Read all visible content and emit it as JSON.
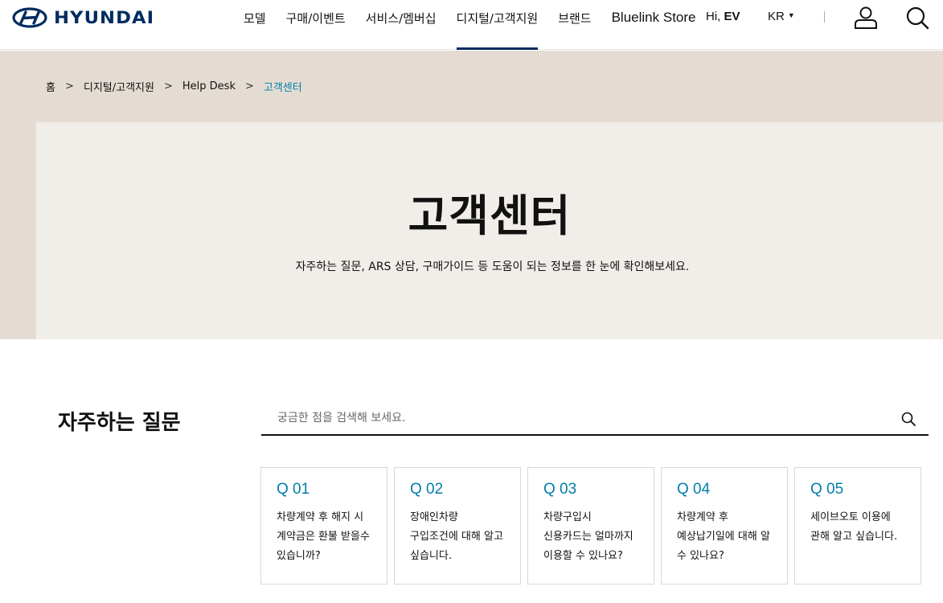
{
  "header": {
    "logo_text": "HYUNDAI",
    "nav": [
      "모델",
      "구매/이벤트",
      "서비스/멤버십",
      "디지털/고객지원",
      "브랜드",
      "Bluelink Store"
    ],
    "active_nav_index": 3,
    "greeting_prefix": "Hi, ",
    "greeting_name": "EV",
    "language": "KR",
    "icons": [
      "user-icon",
      "search-icon"
    ]
  },
  "breadcrumb": [
    "홈",
    "디지털/고객지원",
    "Help Desk",
    "고객센터"
  ],
  "hero": {
    "title": "고객센터",
    "subtitle": "자주하는 질문, ARS 상담, 구매가이드 등 도움이 되는 정보를 한 눈에 확인해보세요."
  },
  "faq": {
    "title": "자주하는 질문",
    "search_placeholder": "궁금한 점을 검색해 보세요.",
    "cards": [
      {
        "q": "Q 01",
        "text": "차량계약 후 해지 시 계약금은 환불 받을수 있습니까?"
      },
      {
        "q": "Q 02",
        "text": "장애인차량 구입조건에 대해 알고 싶습니다."
      },
      {
        "q": "Q 03",
        "text": "차량구입시 신용카드는 얼마까지 이용할 수 있나요?"
      },
      {
        "q": "Q 04",
        "text": "차량계약 후 예상납기일에 대해 알 수 있나요?"
      },
      {
        "q": "Q 05",
        "text": "세이브오토 이용에 관해 알고 싶습니다."
      }
    ]
  },
  "colors": {
    "brand_navy": "#002c5f",
    "accent_teal": "#007fa8",
    "hero_outer": "#e4dcd3",
    "hero_panel": "#f1ede8"
  }
}
